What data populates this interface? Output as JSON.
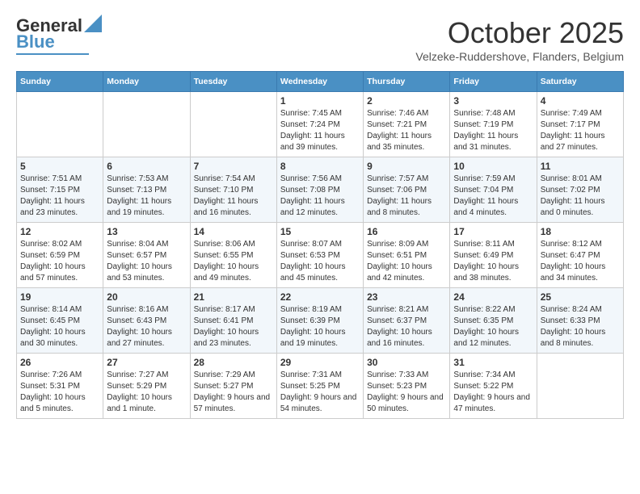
{
  "header": {
    "logo_general": "General",
    "logo_blue": "Blue",
    "month": "October 2025",
    "location": "Velzeke-Ruddershove, Flanders, Belgium"
  },
  "days_of_week": [
    "Sunday",
    "Monday",
    "Tuesday",
    "Wednesday",
    "Thursday",
    "Friday",
    "Saturday"
  ],
  "weeks": [
    {
      "days": [
        {
          "num": "",
          "info": ""
        },
        {
          "num": "",
          "info": ""
        },
        {
          "num": "",
          "info": ""
        },
        {
          "num": "1",
          "info": "Sunrise: 7:45 AM\nSunset: 7:24 PM\nDaylight: 11 hours and 39 minutes."
        },
        {
          "num": "2",
          "info": "Sunrise: 7:46 AM\nSunset: 7:21 PM\nDaylight: 11 hours and 35 minutes."
        },
        {
          "num": "3",
          "info": "Sunrise: 7:48 AM\nSunset: 7:19 PM\nDaylight: 11 hours and 31 minutes."
        },
        {
          "num": "4",
          "info": "Sunrise: 7:49 AM\nSunset: 7:17 PM\nDaylight: 11 hours and 27 minutes."
        }
      ]
    },
    {
      "days": [
        {
          "num": "5",
          "info": "Sunrise: 7:51 AM\nSunset: 7:15 PM\nDaylight: 11 hours and 23 minutes."
        },
        {
          "num": "6",
          "info": "Sunrise: 7:53 AM\nSunset: 7:13 PM\nDaylight: 11 hours and 19 minutes."
        },
        {
          "num": "7",
          "info": "Sunrise: 7:54 AM\nSunset: 7:10 PM\nDaylight: 11 hours and 16 minutes."
        },
        {
          "num": "8",
          "info": "Sunrise: 7:56 AM\nSunset: 7:08 PM\nDaylight: 11 hours and 12 minutes."
        },
        {
          "num": "9",
          "info": "Sunrise: 7:57 AM\nSunset: 7:06 PM\nDaylight: 11 hours and 8 minutes."
        },
        {
          "num": "10",
          "info": "Sunrise: 7:59 AM\nSunset: 7:04 PM\nDaylight: 11 hours and 4 minutes."
        },
        {
          "num": "11",
          "info": "Sunrise: 8:01 AM\nSunset: 7:02 PM\nDaylight: 11 hours and 0 minutes."
        }
      ]
    },
    {
      "days": [
        {
          "num": "12",
          "info": "Sunrise: 8:02 AM\nSunset: 6:59 PM\nDaylight: 10 hours and 57 minutes."
        },
        {
          "num": "13",
          "info": "Sunrise: 8:04 AM\nSunset: 6:57 PM\nDaylight: 10 hours and 53 minutes."
        },
        {
          "num": "14",
          "info": "Sunrise: 8:06 AM\nSunset: 6:55 PM\nDaylight: 10 hours and 49 minutes."
        },
        {
          "num": "15",
          "info": "Sunrise: 8:07 AM\nSunset: 6:53 PM\nDaylight: 10 hours and 45 minutes."
        },
        {
          "num": "16",
          "info": "Sunrise: 8:09 AM\nSunset: 6:51 PM\nDaylight: 10 hours and 42 minutes."
        },
        {
          "num": "17",
          "info": "Sunrise: 8:11 AM\nSunset: 6:49 PM\nDaylight: 10 hours and 38 minutes."
        },
        {
          "num": "18",
          "info": "Sunrise: 8:12 AM\nSunset: 6:47 PM\nDaylight: 10 hours and 34 minutes."
        }
      ]
    },
    {
      "days": [
        {
          "num": "19",
          "info": "Sunrise: 8:14 AM\nSunset: 6:45 PM\nDaylight: 10 hours and 30 minutes."
        },
        {
          "num": "20",
          "info": "Sunrise: 8:16 AM\nSunset: 6:43 PM\nDaylight: 10 hours and 27 minutes."
        },
        {
          "num": "21",
          "info": "Sunrise: 8:17 AM\nSunset: 6:41 PM\nDaylight: 10 hours and 23 minutes."
        },
        {
          "num": "22",
          "info": "Sunrise: 8:19 AM\nSunset: 6:39 PM\nDaylight: 10 hours and 19 minutes."
        },
        {
          "num": "23",
          "info": "Sunrise: 8:21 AM\nSunset: 6:37 PM\nDaylight: 10 hours and 16 minutes."
        },
        {
          "num": "24",
          "info": "Sunrise: 8:22 AM\nSunset: 6:35 PM\nDaylight: 10 hours and 12 minutes."
        },
        {
          "num": "25",
          "info": "Sunrise: 8:24 AM\nSunset: 6:33 PM\nDaylight: 10 hours and 8 minutes."
        }
      ]
    },
    {
      "days": [
        {
          "num": "26",
          "info": "Sunrise: 7:26 AM\nSunset: 5:31 PM\nDaylight: 10 hours and 5 minutes."
        },
        {
          "num": "27",
          "info": "Sunrise: 7:27 AM\nSunset: 5:29 PM\nDaylight: 10 hours and 1 minute."
        },
        {
          "num": "28",
          "info": "Sunrise: 7:29 AM\nSunset: 5:27 PM\nDaylight: 9 hours and 57 minutes."
        },
        {
          "num": "29",
          "info": "Sunrise: 7:31 AM\nSunset: 5:25 PM\nDaylight: 9 hours and 54 minutes."
        },
        {
          "num": "30",
          "info": "Sunrise: 7:33 AM\nSunset: 5:23 PM\nDaylight: 9 hours and 50 minutes."
        },
        {
          "num": "31",
          "info": "Sunrise: 7:34 AM\nSunset: 5:22 PM\nDaylight: 9 hours and 47 minutes."
        },
        {
          "num": "",
          "info": ""
        }
      ]
    }
  ]
}
